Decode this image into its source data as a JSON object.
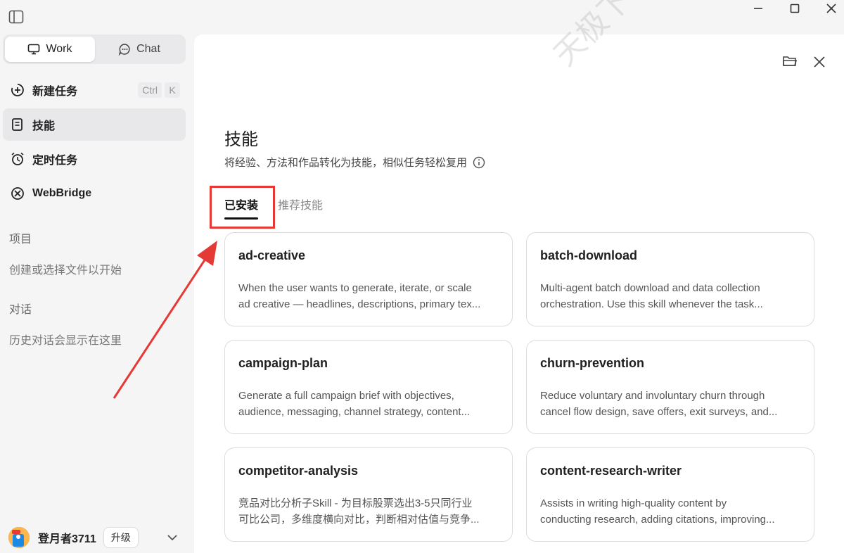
{
  "sidebar": {
    "modes": [
      {
        "label": "Work",
        "icon": "monitor-icon"
      },
      {
        "label": "Chat",
        "icon": "chat-bubble-icon"
      }
    ],
    "items": [
      {
        "label": "新建任务",
        "icon": "plus-circle-icon",
        "shortcut": [
          "Ctrl",
          "K"
        ]
      },
      {
        "label": "技能",
        "icon": "skill-book-icon",
        "active": true
      },
      {
        "label": "定时任务",
        "icon": "alarm-clock-icon"
      },
      {
        "label": "WebBridge",
        "icon": "bridge-icon"
      }
    ],
    "projects_label": "项目",
    "projects_hint": "创建或选择文件以开始",
    "conversations_label": "对话",
    "conversations_hint": "历史对话会显示在这里",
    "user": {
      "name": "登月者3711",
      "upgrade_label": "升级"
    }
  },
  "main": {
    "title": "技能",
    "subtitle": "将经验、方法和作品转化为技能，相似任务轻松复用",
    "tabs": [
      {
        "label": "已安装",
        "active": true
      },
      {
        "label": "推荐技能",
        "active": false
      }
    ],
    "cards": [
      {
        "title": "ad-creative",
        "desc1": "When the user wants to generate, iterate, or scale",
        "desc2": "ad creative — headlines, descriptions, primary tex..."
      },
      {
        "title": "batch-download",
        "desc1": "Multi-agent batch download and data collection",
        "desc2": "orchestration. Use this skill whenever the task..."
      },
      {
        "title": "campaign-plan",
        "desc1": "Generate a full campaign brief with objectives,",
        "desc2": "audience, messaging, channel strategy, content..."
      },
      {
        "title": "churn-prevention",
        "desc1": "Reduce voluntary and involuntary churn through",
        "desc2": "cancel flow design, save offers, exit surveys, and..."
      },
      {
        "title": "competitor-analysis",
        "desc1": "竞品对比分析子Skill - 为目标股票选出3-5只同行业",
        "desc2": "可比公司，多维度横向对比，判断相对估值与竞争..."
      },
      {
        "title": "content-research-writer",
        "desc1": "Assists in writing high-quality content by",
        "desc2": "conducting research, adding citations, improving..."
      }
    ]
  },
  "watermark": "天极下载站 mydown.yesky.com",
  "colors": {
    "annotation_red": "#e53935",
    "active_bg": "#e8e8ea"
  }
}
